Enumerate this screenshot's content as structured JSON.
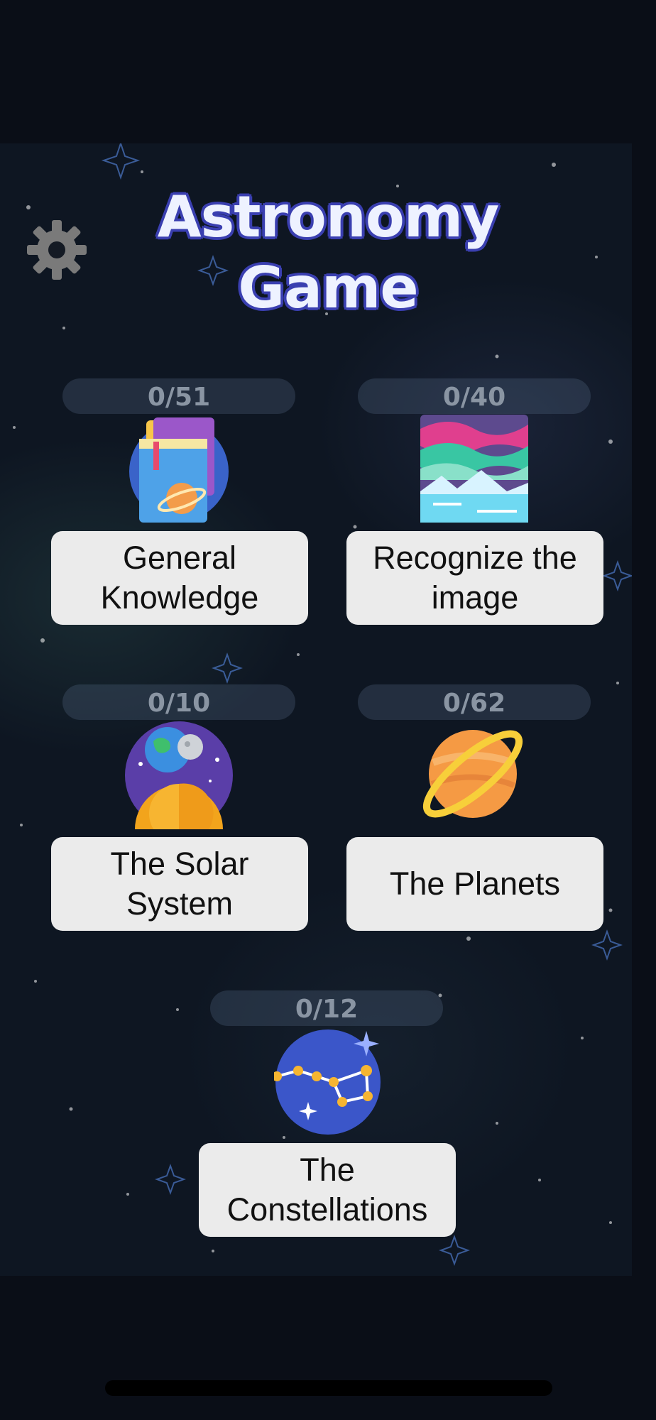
{
  "header": {
    "title_line1": "Astronomy",
    "title_line2": "Game"
  },
  "settings": {
    "icon": "gear-icon"
  },
  "categories": [
    {
      "progress": "0/51",
      "label_line1": "General",
      "label_line2": "Knowledge",
      "icon": "books-icon"
    },
    {
      "progress": "0/40",
      "label_line1": "Recognize the",
      "label_line2": "image",
      "icon": "aurora-image-icon"
    },
    {
      "progress": "0/10",
      "label_line1": "The Solar",
      "label_line2": "System",
      "icon": "solar-system-icon"
    },
    {
      "progress": "0/62",
      "label_line1": "The Planets",
      "label_line2": "",
      "icon": "planet-icon"
    },
    {
      "progress": "0/12",
      "label_line1": "The",
      "label_line2": "Constellations",
      "icon": "constellation-icon"
    }
  ],
  "colors": {
    "background": "#0a0e17",
    "card": "#ebebeb",
    "title_outline": "#3a3fb0",
    "progress_text": "#8a95a3"
  }
}
